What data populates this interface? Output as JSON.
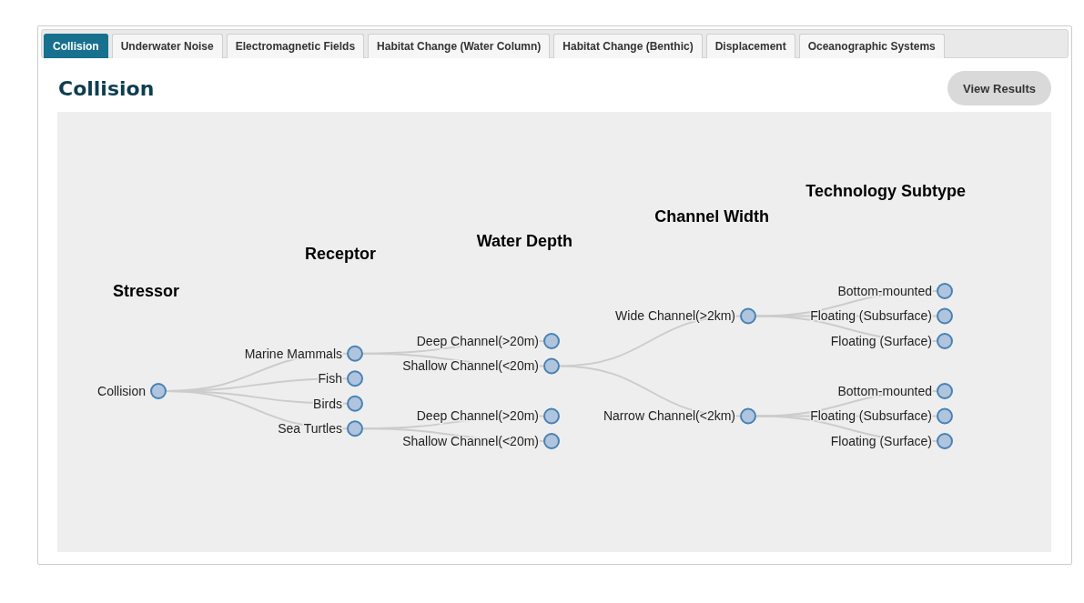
{
  "tabs": [
    {
      "label": "Collision",
      "selected": true
    },
    {
      "label": "Underwater Noise",
      "selected": false
    },
    {
      "label": "Electromagnetic Fields",
      "selected": false
    },
    {
      "label": "Habitat Change (Water Column)",
      "selected": false
    },
    {
      "label": "Habitat Change (Benthic)",
      "selected": false
    },
    {
      "label": "Displacement",
      "selected": false
    },
    {
      "label": "Oceanographic Systems",
      "selected": false
    }
  ],
  "title": "Collision",
  "view_results_button": "View Results",
  "tree": {
    "level_headings": [
      "Stressor",
      "Receptor",
      "Water Depth",
      "Channel Width",
      "Technology Subtype"
    ],
    "root": {
      "label": "Collision",
      "children": [
        {
          "label": "Marine Mammals",
          "children": [
            {
              "label": "Deep Channel(>20m)"
            },
            {
              "label": "Shallow Channel(<20m)",
              "children": [
                {
                  "label": "Wide Channel(>2km)",
                  "children": [
                    {
                      "label": "Bottom-mounted"
                    },
                    {
                      "label": "Floating (Subsurface)"
                    },
                    {
                      "label": "Floating (Surface)"
                    }
                  ]
                },
                {
                  "label": "Narrow Channel(<2km)",
                  "children": [
                    {
                      "label": "Bottom-mounted"
                    },
                    {
                      "label": "Floating (Subsurface)"
                    },
                    {
                      "label": "Floating (Surface)"
                    }
                  ]
                }
              ]
            }
          ]
        },
        {
          "label": "Fish"
        },
        {
          "label": "Birds"
        },
        {
          "label": "Sea Turtles",
          "children": [
            {
              "label": "Deep Channel(>20m)"
            },
            {
              "label": "Shallow Channel(<20m)"
            }
          ]
        }
      ]
    }
  }
}
